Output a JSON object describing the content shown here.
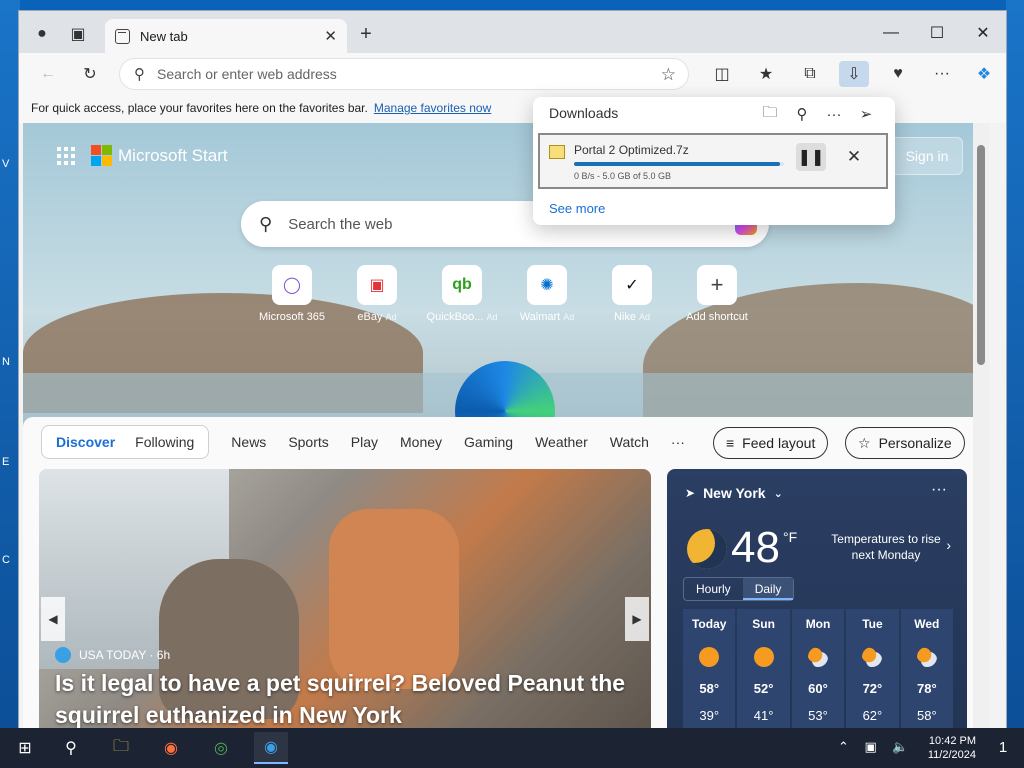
{
  "desktop": {
    "edge_letters": [
      "V",
      "N",
      "E",
      "C"
    ]
  },
  "browser": {
    "tab_title": "New tab",
    "address_placeholder": "Search or enter web address",
    "favbar_text": "For quick access, place your favorites here on the favorites bar.",
    "favbar_link": "Manage favorites now"
  },
  "downloads": {
    "header": "Downloads",
    "file_name": "Portal 2 Optimized.7z",
    "progress_pct": 98,
    "meta": "0 B/s - 5.0 GB of 5.0 GB",
    "see_more": "See more"
  },
  "start": {
    "brand": "Microsoft Start",
    "sign_in": "Sign in",
    "search_placeholder": "Search the web",
    "quick_links": [
      {
        "label": "Microsoft 365",
        "ad": ""
      },
      {
        "label": "eBay",
        "ad": "Ad"
      },
      {
        "label": "QuickBoo...",
        "ad": "Ad"
      },
      {
        "label": "Walmart",
        "ad": "Ad"
      },
      {
        "label": "Nike",
        "ad": "Ad"
      },
      {
        "label": "Add shortcut",
        "ad": ""
      }
    ]
  },
  "feed": {
    "tab_discover": "Discover",
    "tab_following": "Following",
    "nav": [
      "News",
      "Sports",
      "Play",
      "Money",
      "Gaming",
      "Weather",
      "Watch",
      "···"
    ],
    "feed_layout": "Feed layout",
    "personalize": "Personalize",
    "hero_source": "USA TODAY · 6h",
    "hero_headline": "Is it legal to have a pet squirrel? Beloved Peanut the squirrel euthanized in New York"
  },
  "weather": {
    "location": "New York",
    "temp": "48",
    "unit": "°F",
    "alert": "Temperatures to rise next Monday",
    "toggle_hourly": "Hourly",
    "toggle_daily": "Daily",
    "days": [
      {
        "name": "Today",
        "hi": "58°",
        "lo": "39°"
      },
      {
        "name": "Sun",
        "hi": "52°",
        "lo": "41°"
      },
      {
        "name": "Mon",
        "hi": "60°",
        "lo": "53°"
      },
      {
        "name": "Tue",
        "hi": "72°",
        "lo": "62°"
      },
      {
        "name": "Wed",
        "hi": "78°",
        "lo": "58°"
      }
    ]
  },
  "taskbar": {
    "time": "10:42 PM",
    "date": "11/2/2024",
    "notif_count": "1"
  }
}
